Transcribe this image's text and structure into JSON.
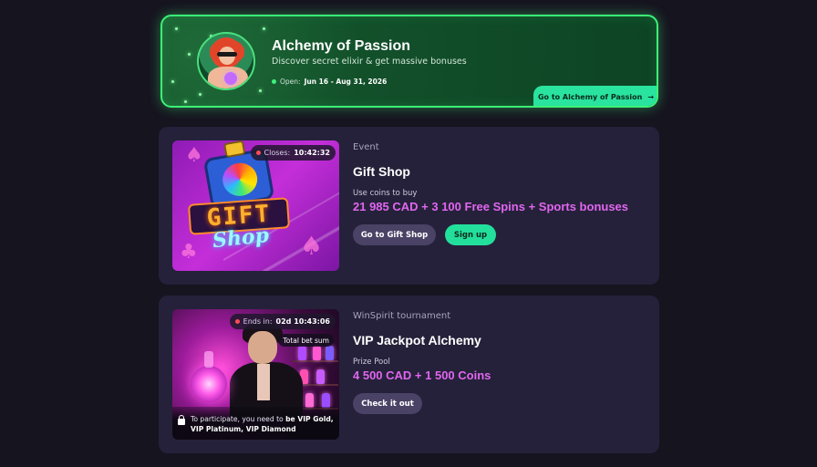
{
  "promo": {
    "title": "Alchemy of Passion",
    "subtitle": "Discover secret elixir & get massive bonuses",
    "open_label": "Open:",
    "dates": "Jun 16 - Aug 31, 2026",
    "button_label": "Go to Alchemy of Passion",
    "accent_color": "#3cf277"
  },
  "gift_shop": {
    "timer_label": "Closes:",
    "timer_value": "10:42:32",
    "artwork_sign": "GIFT",
    "artwork_script": "Shop",
    "kicker": "Event",
    "title": "Gift Shop",
    "label": "Use coins to buy",
    "amount": "21 985 CAD + 3 100 Free Spins + Sports bonuses",
    "primary_button": "Go to Gift Shop",
    "secondary_button": "Sign up"
  },
  "vip_tournament": {
    "timer_label": "Ends in:",
    "timer_value": "02d 10:43:06",
    "tag": "Total bet sum",
    "requirement_prefix": "To participate, you need to ",
    "requirement_levels": "be VIP Gold, VIP Platinum, VIP Diamond",
    "kicker": "WinSpirit tournament",
    "title": "VIP Jackpot Alchemy",
    "label": "Prize Pool",
    "amount": "4 500 CAD + 1 500 Coins",
    "button": "Check it out"
  },
  "colors": {
    "background": "#16141f",
    "card": "#25213a",
    "amount": "#e166ef",
    "green_button": "#23df9c",
    "dark_button": "#4a4366"
  }
}
